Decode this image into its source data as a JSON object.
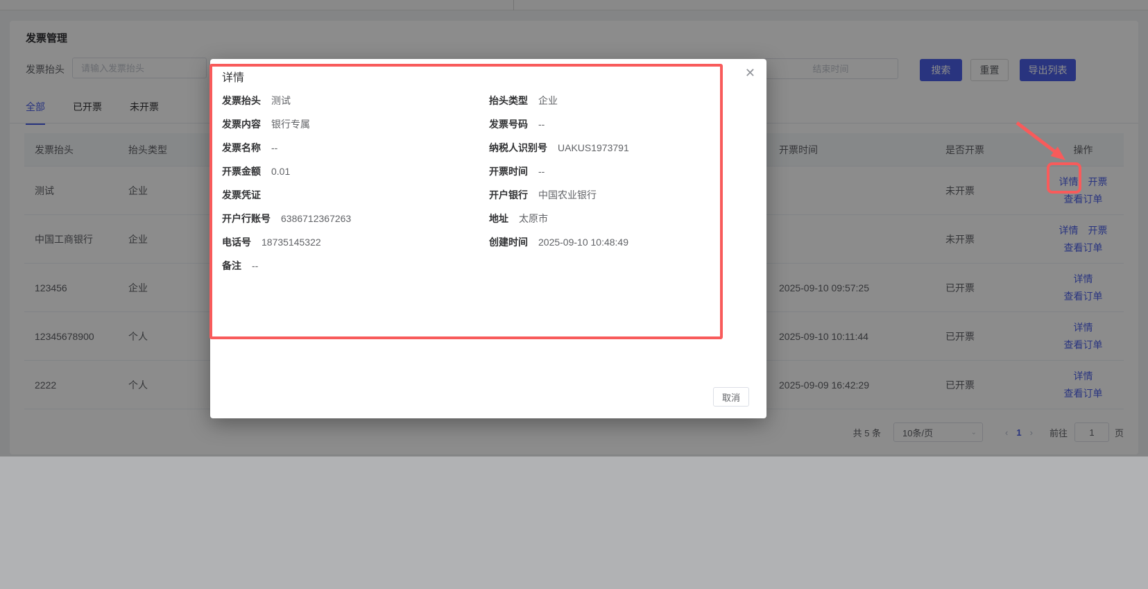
{
  "page": {
    "title": "发票管理"
  },
  "search": {
    "label": "发票抬头",
    "placeholder": "请输入发票抬头",
    "end_time_placeholder": "结束时间",
    "search_label": "搜索",
    "reset_label": "重置",
    "export_label": "导出列表"
  },
  "tabs": [
    {
      "label": "全部",
      "active": true
    },
    {
      "label": "已开票",
      "active": false
    },
    {
      "label": "未开票",
      "active": false
    }
  ],
  "table": {
    "headers": [
      "发票抬头",
      "抬头类型",
      "开票时间",
      "是否开票",
      "操作"
    ],
    "rows": [
      {
        "title": "测试",
        "type": "企业",
        "invoice_time": "",
        "status": "未开票",
        "actions": [
          "详情",
          "开票",
          "查看订单"
        ]
      },
      {
        "title": "中国工商银行",
        "type": "企业",
        "invoice_time": "",
        "status": "未开票",
        "actions": [
          "详情",
          "开票",
          "查看订单"
        ]
      },
      {
        "title": "123456",
        "type": "企业",
        "invoice_time": "2025-09-10 09:57:25",
        "status": "已开票",
        "actions": [
          "详情",
          "查看订单"
        ]
      },
      {
        "title": "12345678900",
        "type": "个人",
        "invoice_time": "2025-09-10 10:11:44",
        "status": "已开票",
        "actions": [
          "详情",
          "查看订单"
        ]
      },
      {
        "title": "2222",
        "type": "个人",
        "invoice_time": "2025-09-09 16:42:29",
        "status": "已开票",
        "actions": [
          "详情",
          "查看订单"
        ]
      }
    ]
  },
  "pagination": {
    "total": "共 5 条",
    "page_size": "10条/页",
    "chevron_icon": "⌄",
    "prev_icon": "‹",
    "current_page": "1",
    "next_icon": "›",
    "goto_label": "前往",
    "goto_value": "1",
    "page_unit": "页"
  },
  "modal": {
    "title": "详情",
    "close_icon": "✕",
    "fields_left": [
      {
        "label": "发票抬头",
        "value": "测试"
      },
      {
        "label": "发票内容",
        "value": "银行专属"
      },
      {
        "label": "发票名称",
        "value": "--"
      },
      {
        "label": "开票金额",
        "value": "0.01"
      },
      {
        "label": "发票凭证",
        "value": ""
      },
      {
        "label": "开户行账号",
        "value": "6386712367263"
      },
      {
        "label": "电话号",
        "value": "18735145322"
      },
      {
        "label": "备注",
        "value": "--"
      }
    ],
    "fields_right": [
      {
        "label": "抬头类型",
        "value": "企业"
      },
      {
        "label": "发票号码",
        "value": "--"
      },
      {
        "label": "纳税人识别号",
        "value": "UAKUS1973791"
      },
      {
        "label": "开票时间",
        "value": "--"
      },
      {
        "label": "开户银行",
        "value": "中国农业银行"
      },
      {
        "label": "地址",
        "value": "太原市"
      },
      {
        "label": "创建时间",
        "value": "2025-09-10 10:48:49"
      }
    ],
    "cancel_label": "取消"
  },
  "colors": {
    "accent": "#4c60e8",
    "link": "#4c60e8",
    "annotation": "#f85b5b"
  }
}
